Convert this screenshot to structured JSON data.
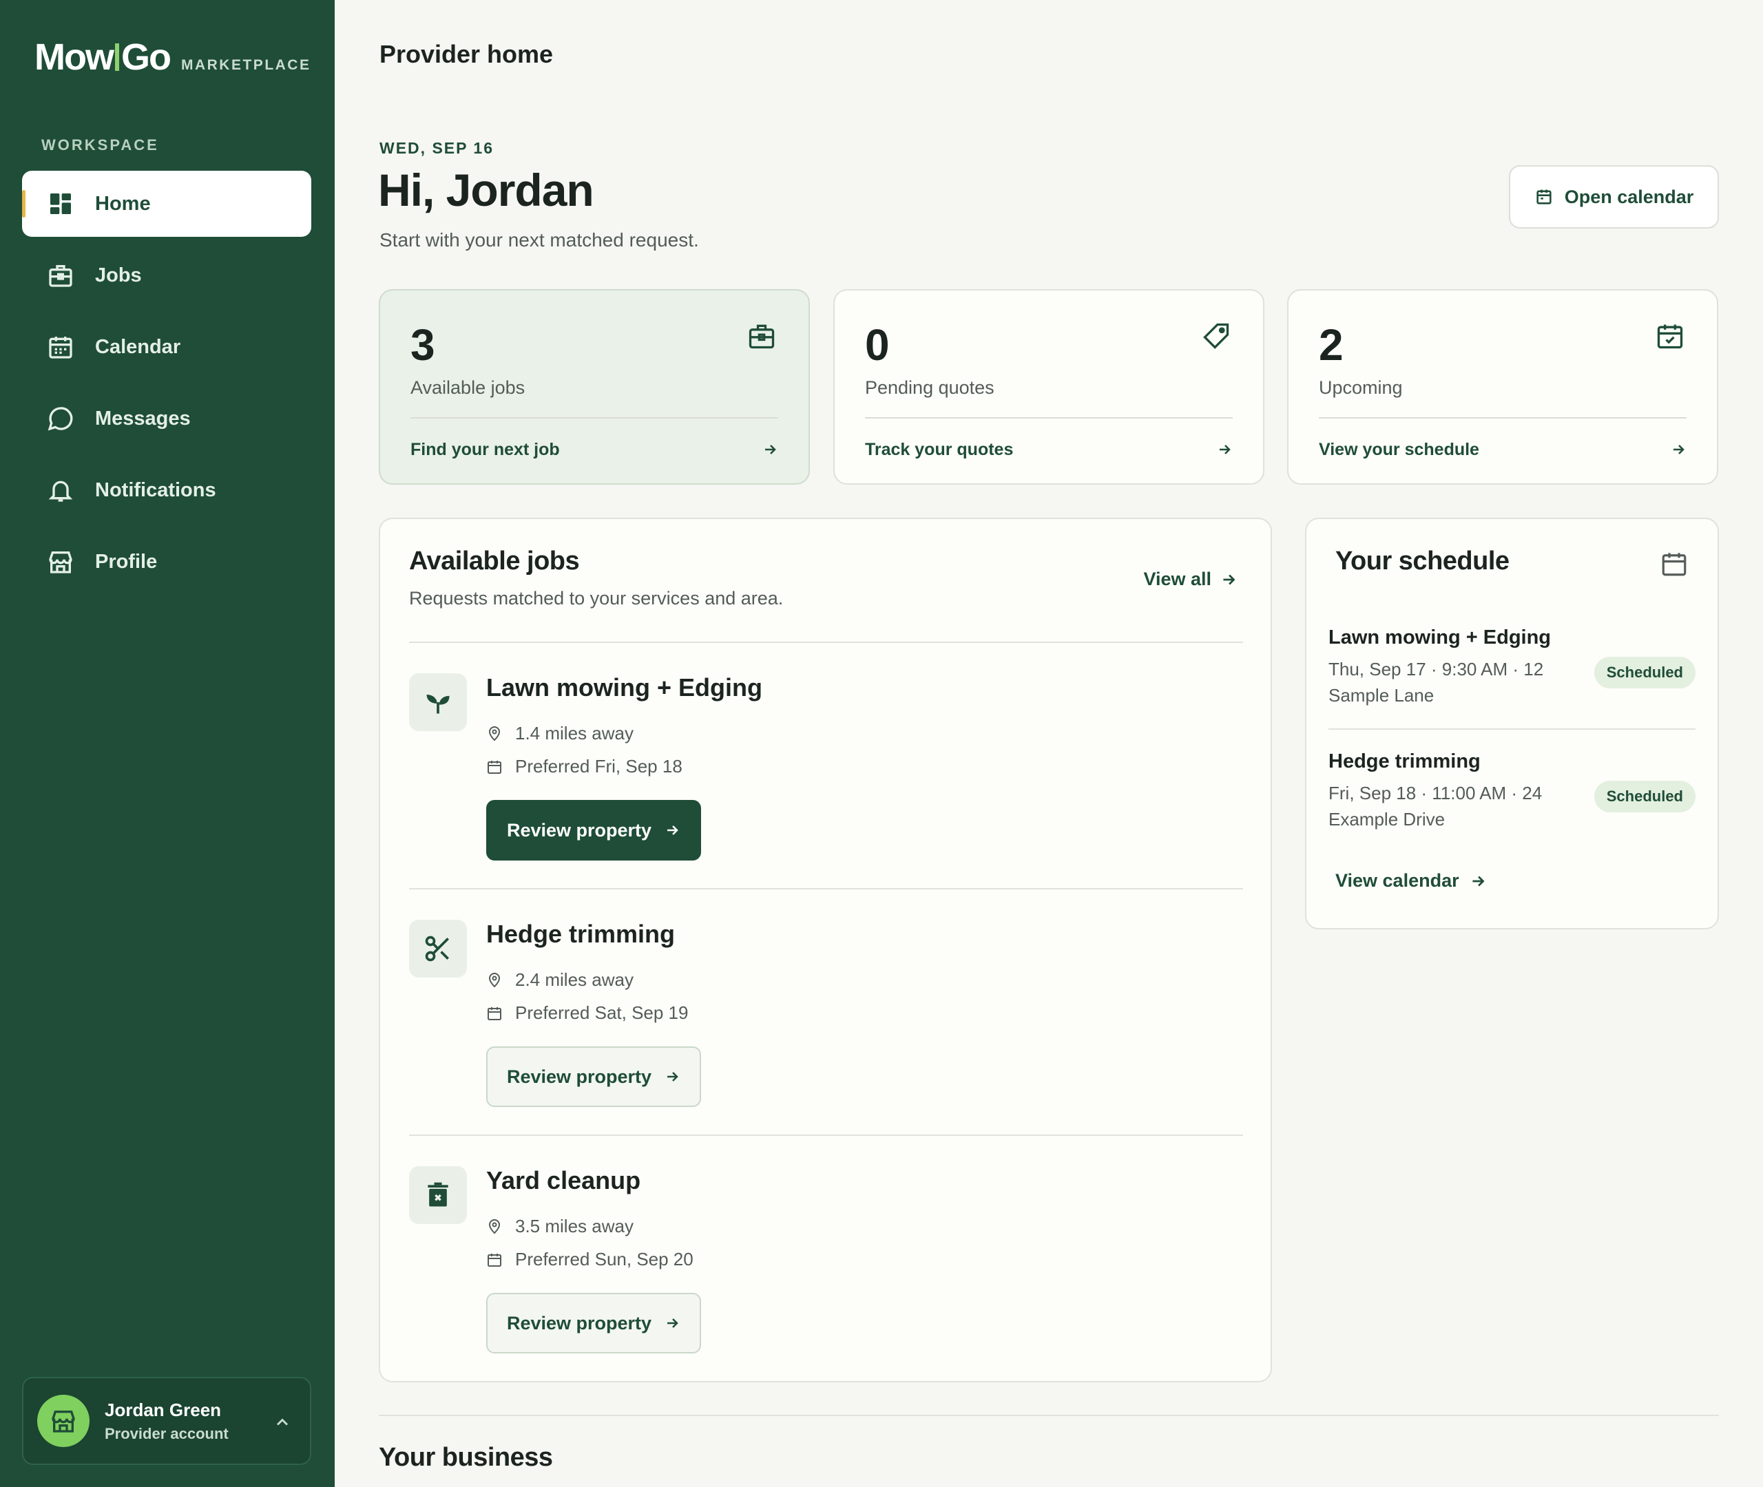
{
  "brand": {
    "logo_left": "Mow",
    "logo_right": "Go",
    "sub": "MARKETPLACE"
  },
  "sidebar": {
    "section_label": "WORKSPACE",
    "items": [
      {
        "label": "Home",
        "icon": "dashboard-icon",
        "active": true
      },
      {
        "label": "Jobs",
        "icon": "briefcase-icon"
      },
      {
        "label": "Calendar",
        "icon": "calendar-icon"
      },
      {
        "label": "Messages",
        "icon": "chat-bubble-icon"
      },
      {
        "label": "Notifications",
        "icon": "bell-icon"
      },
      {
        "label": "Profile",
        "icon": "storefront-icon"
      }
    ],
    "account": {
      "name": "Jordan Green",
      "role": "Provider account",
      "avatar_icon": "storefront-icon"
    }
  },
  "header": {
    "title": "Provider home"
  },
  "welcome": {
    "date": "WED, SEP 16",
    "greeting": "Hi, Jordan",
    "subline": "Start with your next matched request.",
    "open_calendar_label": "Open calendar"
  },
  "stats": [
    {
      "value": "3",
      "label": "Available jobs",
      "link": "Find your next job",
      "icon": "briefcase-icon"
    },
    {
      "value": "0",
      "label": "Pending quotes",
      "link": "Track your quotes",
      "icon": "tag-icon"
    },
    {
      "value": "2",
      "label": "Upcoming",
      "link": "View your schedule",
      "icon": "calendar-check-icon"
    }
  ],
  "available_jobs": {
    "title": "Available jobs",
    "subtitle": "Requests matched to your services and area.",
    "view_all": "View all",
    "jobs": [
      {
        "title": "Lawn mowing + Edging",
        "distance": "1.4 miles away",
        "preferred": "Preferred Fri, Sep 18",
        "button": "Review property",
        "icon": "sprout-icon"
      },
      {
        "title": "Hedge trimming",
        "distance": "2.4 miles away",
        "preferred": "Preferred Sat, Sep 19",
        "button": "Review property",
        "icon": "scissors-icon"
      },
      {
        "title": "Yard cleanup",
        "distance": "3.5 miles away",
        "preferred": "Preferred Sun, Sep 20",
        "button": "Review property",
        "icon": "trash-icon"
      }
    ]
  },
  "schedule": {
    "title": "Your schedule",
    "items": [
      {
        "title": "Lawn mowing + Edging",
        "detail": "Thu, Sep 17 · 9:30 AM · 12 Sample Lane",
        "status": "Scheduled"
      },
      {
        "title": "Hedge trimming",
        "detail": "Fri, Sep 18 · 11:00 AM · 24 Example Drive",
        "status": "Scheduled"
      }
    ],
    "view_calendar": "View calendar"
  },
  "business": {
    "title": "Your business"
  },
  "colors": {
    "sidebar_bg": "#1f4d37",
    "accent_green": "#7fd05e",
    "active_marker": "#e7b54a",
    "page_bg": "#f6f6f2"
  }
}
